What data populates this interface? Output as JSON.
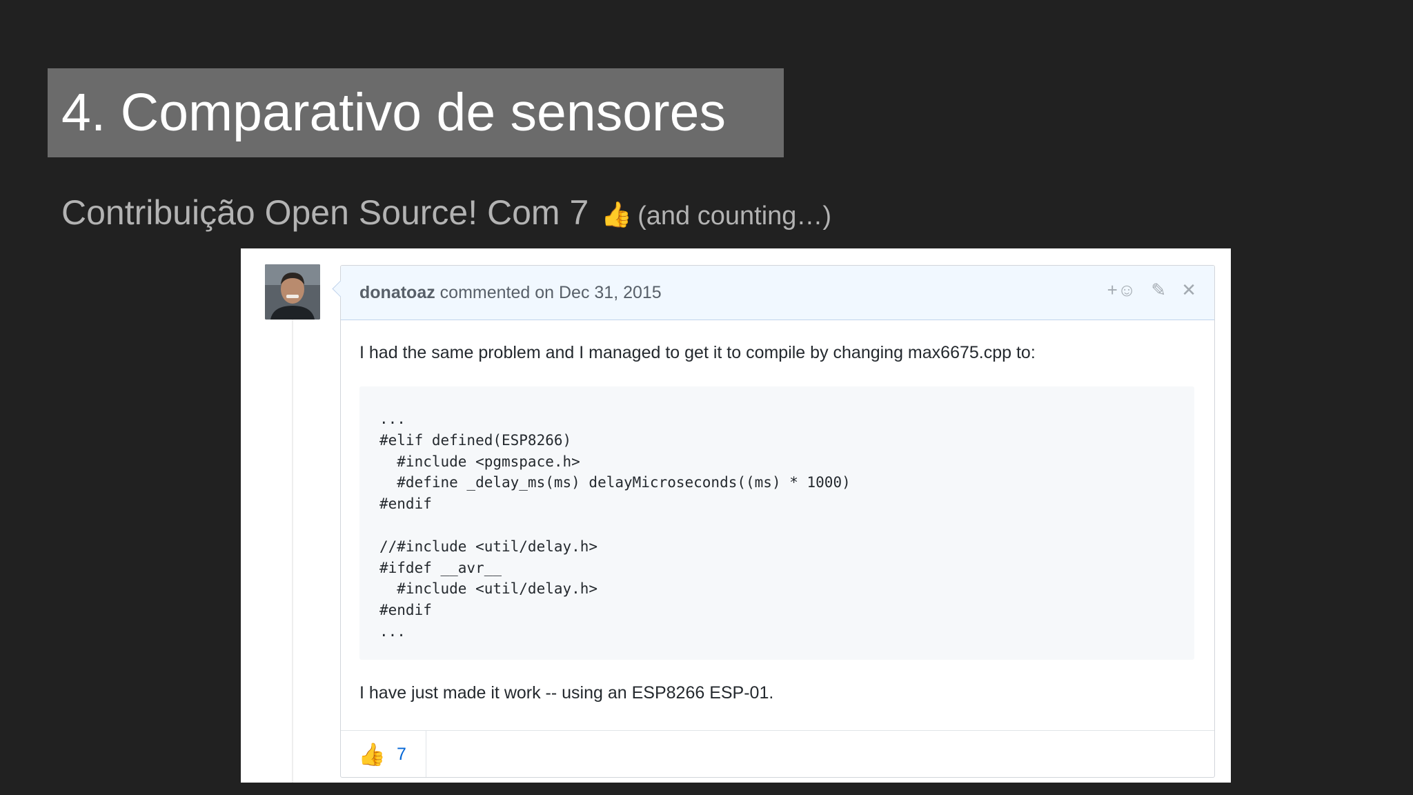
{
  "slide": {
    "title": "4. Comparativo de sensores",
    "subtitle": "Contribuição Open Source! Com 7",
    "thumb_glyph": "👍",
    "subtitle_suffix": "(and counting…)"
  },
  "comment": {
    "author": "donatoaz",
    "action": "commented on Dec 31, 2015",
    "actions": {
      "add_reaction": "+☺",
      "edit": "✎",
      "delete": "✕"
    },
    "body_intro": "I had the same problem and I managed to get it to compile by changing max6675.cpp to:",
    "code": "...\n#elif defined(ESP8266)\n  #include <pgmspace.h>\n  #define _delay_ms(ms) delayMicroseconds((ms) * 1000)\n#endif\n\n//#include <util/delay.h>\n#ifdef __avr__\n  #include <util/delay.h>\n#endif\n...",
    "body_outro": "I have just made it work -- using an ESP8266 ESP-01.",
    "reaction": {
      "emoji": "👍",
      "count": "7"
    }
  },
  "icons": {
    "thumb": "thumbs-up-icon",
    "add_reaction": "smiley-plus-icon",
    "edit": "pencil-icon",
    "delete": "close-icon"
  },
  "colors": {
    "background": "#212121",
    "title_box": "#6b6b6b",
    "header_bg": "#f1f8ff",
    "link": "#0366d6"
  }
}
